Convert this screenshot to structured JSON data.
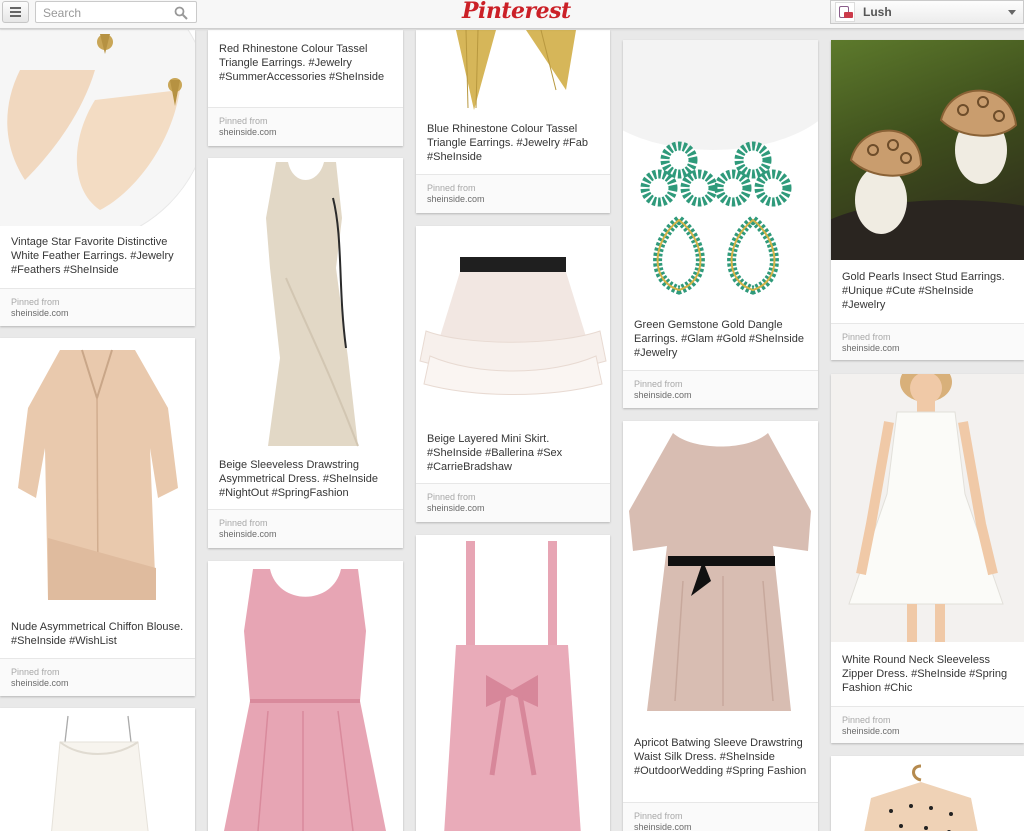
{
  "header": {
    "search_placeholder": "Search",
    "logo_text": "Pinterest",
    "user_name": "Lush"
  },
  "colors": {
    "brand": "#cb2027",
    "background": "#e9e9e9"
  },
  "icons": {
    "menu": "hamburger-menu-icon",
    "search": "search-icon",
    "caret": "chevron-down-icon"
  },
  "pinned_label": "Pinned from",
  "pins": [
    {
      "description": "Vintage Star Favorite Distinctive White Feather Earrings. #Jewelry #Feathers #SheInside",
      "source": "sheinside.com"
    },
    {
      "description": "Nude Asymmetrical Chiffon Blouse. #SheInside #WishList",
      "source": "sheinside.com"
    },
    {
      "description": "",
      "source": ""
    },
    {
      "description": "Red Rhinestone Colour Tassel Triangle Earrings. #Jewelry #SummerAccessories #SheInside",
      "source": "sheinside.com"
    },
    {
      "description": "Beige Sleeveless Drawstring Asymmetrical Dress. #SheInside #NightOut #SpringFashion",
      "source": "sheinside.com"
    },
    {
      "description": "",
      "source": ""
    },
    {
      "description": "Blue Rhinestone Colour Tassel Triangle Earrings. #Jewelry #Fab #SheInside",
      "source": "sheinside.com"
    },
    {
      "description": "Beige Layered Mini Skirt. #SheInside #Ballerina #Sex #CarrieBradshaw",
      "source": "sheinside.com"
    },
    {
      "description": "",
      "source": ""
    },
    {
      "description": "Green Gemstone Gold Dangle Earrings. #Glam #Gold #SheInside #Jewelry",
      "source": "sheinside.com"
    },
    {
      "description": "Apricot Batwing Sleeve Drawstring Waist Silk Dress. #SheInside #OutdoorWedding #Spring Fashion",
      "source": "sheinside.com"
    },
    {
      "description": "Gold Pearls Insect Stud Earrings. #Unique #Cute #SheInside #Jewelry",
      "source": "sheinside.com"
    },
    {
      "description": "White Round Neck Sleeveless Zipper Dress. #SheInside #Spring Fashion #Chic",
      "source": "sheinside.com"
    },
    {
      "description": "",
      "source": ""
    }
  ]
}
